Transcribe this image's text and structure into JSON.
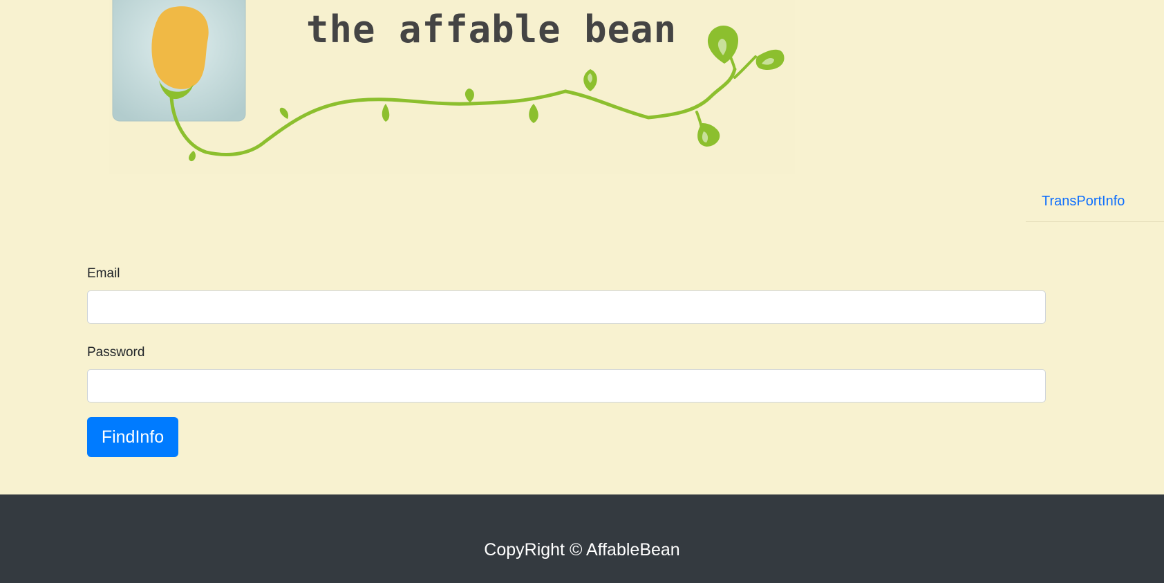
{
  "header": {
    "logo_text": "the affable bean"
  },
  "nav": {
    "link_label": "TransPortInfo"
  },
  "form": {
    "email_label": "Email",
    "email_value": "",
    "password_label": "Password",
    "password_value": "",
    "submit_label": "FindInfo"
  },
  "footer": {
    "copyright": "CopyRight © AffableBean"
  },
  "colors": {
    "page_background": "#f8f2d0",
    "link": "#0d6efd",
    "button": "#007bff",
    "footer_background": "#343a40",
    "vine_green": "#8cbf2e",
    "bean_yellow": "#f0b945"
  },
  "icons": {
    "logo": "bean-sprout-logo"
  }
}
